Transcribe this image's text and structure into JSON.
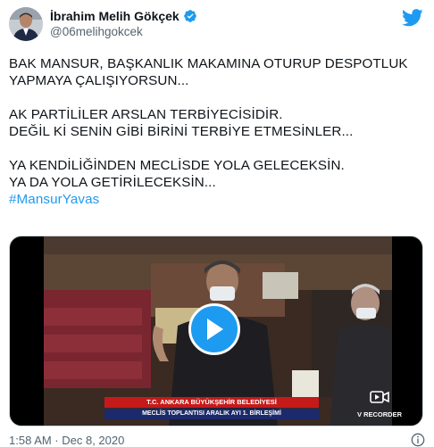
{
  "author": {
    "name": "İbrahim Melih Gökçek",
    "handle": "@06melihgokcek",
    "verified_icon": "verified-badge-icon",
    "avatar_icon": "avatar"
  },
  "brand": {
    "logo_icon": "twitter-bird-icon",
    "accent_color": "#1d9bf0"
  },
  "tweet": {
    "lines": [
      "BAK MANSUR, BAŞKANLIK MAKAMINA OTURUP DESPOTLUK",
      "YAPMAYA ÇALIŞIYORSUN...",
      "",
      "AK PARTİLİLER  ARSLAN TERBİYECİSİDİR.",
      "DEĞİL Kİ SENİN GİBİ BİRİNİ TERBİYE ETMESİNLER...",
      "",
      "YA KENDİLİĞİNDEN MECLİSDE YOLA GELECEKSİN.",
      "YA DA YOLA GETİRİLECEKSİN..."
    ],
    "hashtag": "#MansurYavas"
  },
  "media": {
    "play_icon": "play-icon",
    "caption_title": "T.C. ANKARA BÜYÜKŞEHİR BELEDİYESİ",
    "caption_subtitle": "MECLİS TOPLANTISI ARALIK AYI 1. BİRLEŞİMİ",
    "recorder_label": "V RECORDER",
    "recorder_icon": "video-camera-icon"
  },
  "footer": {
    "timestamp": "1:58 AM · Dec 8, 2020",
    "info_icon": "info-icon"
  }
}
